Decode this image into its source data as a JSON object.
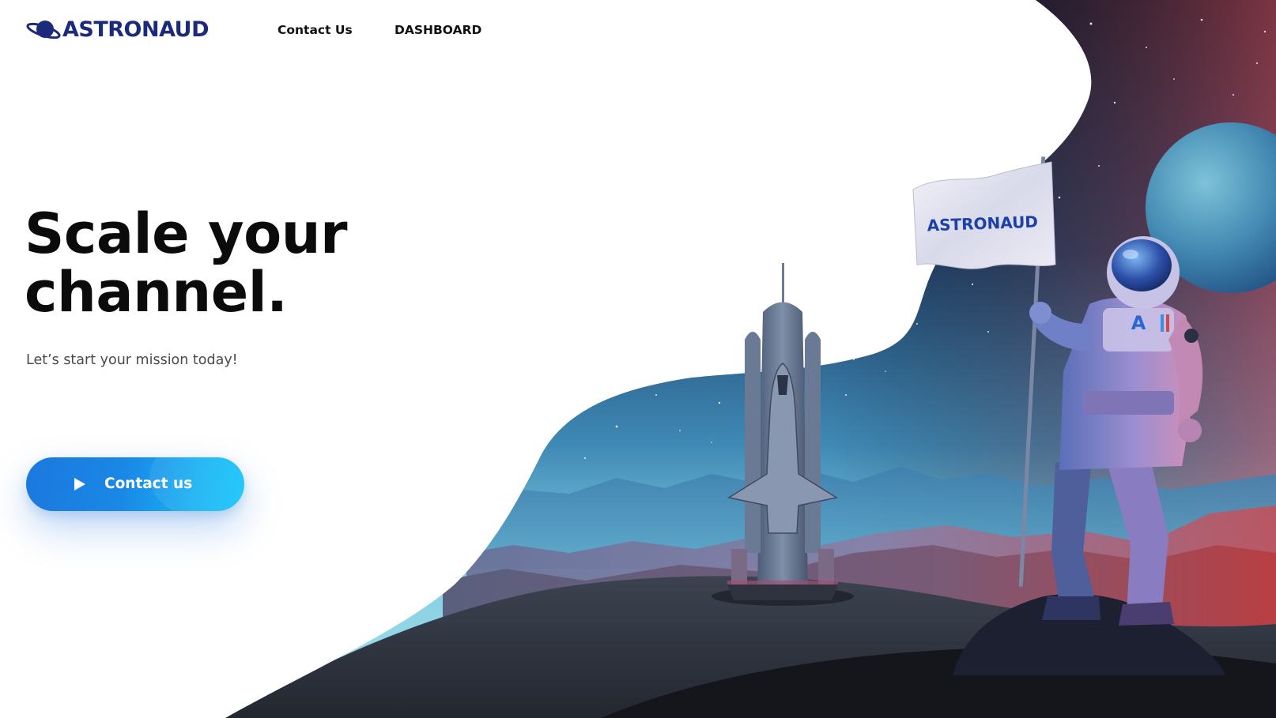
{
  "brand": {
    "name": "ASTRONAUD",
    "logo_icon": "planet-ring-icon",
    "color": "#1b2a7a"
  },
  "nav": {
    "links": [
      {
        "label": "Contact Us"
      },
      {
        "label": "DASHBOARD"
      }
    ]
  },
  "hero": {
    "title_line1": "Scale your",
    "title_line2": "channel.",
    "subtitle": "Let’s start your mission today!",
    "cta": {
      "label": "Contact us",
      "icon": "play-icon",
      "gradient": [
        "#1b78dc",
        "#12c6fb"
      ]
    }
  },
  "illustration": {
    "flag_text": "ASTRONAUD",
    "suit_badge": "A",
    "elements": [
      "space-shuttle",
      "astronaut",
      "flag",
      "planet",
      "mountains",
      "starfield"
    ]
  }
}
